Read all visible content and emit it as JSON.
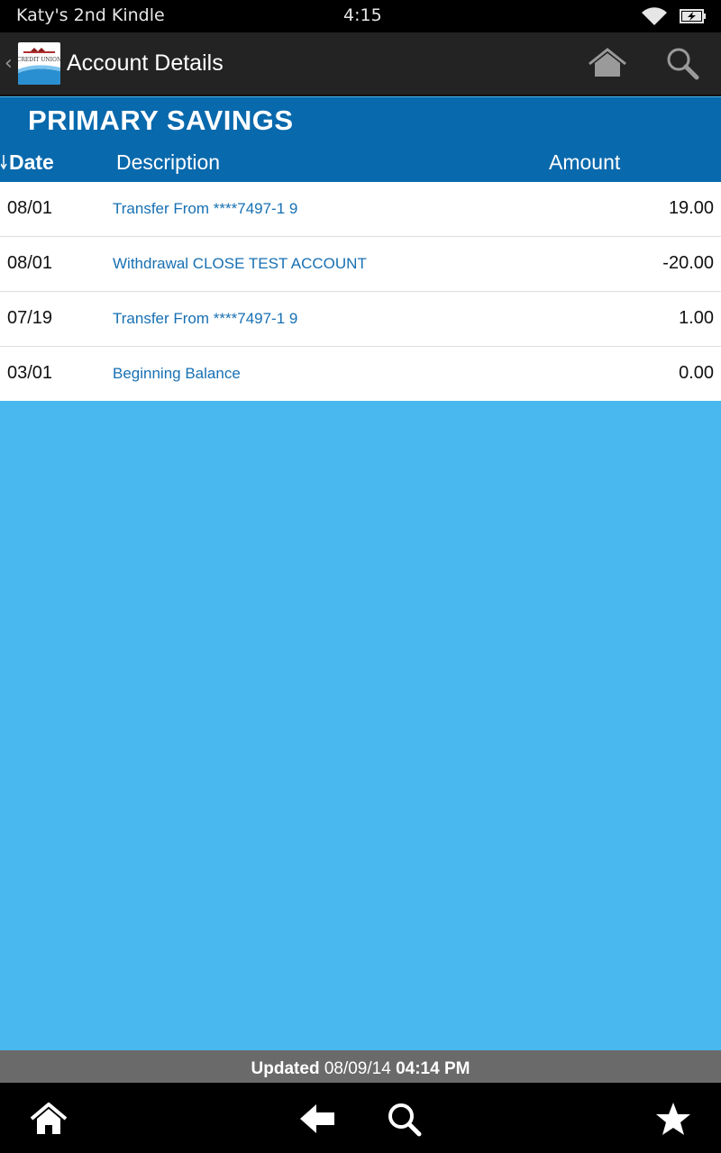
{
  "status_bar": {
    "device_name": "Katy's 2nd Kindle",
    "time": "4:15",
    "icons": [
      "wifi-icon",
      "battery-charging-icon"
    ]
  },
  "action_bar": {
    "logo_text": "CREDIT UNION",
    "title": "Account Details",
    "icons": [
      "home-icon",
      "search-icon"
    ]
  },
  "account": {
    "title": "PRIMARY SAVINGS",
    "columns": {
      "date": "Date",
      "description": "Description",
      "amount": "Amount"
    }
  },
  "transactions": [
    {
      "date": "08/01",
      "description": "Transfer From ****7497-1 9",
      "amount": "19.00"
    },
    {
      "date": "08/01",
      "description": "Withdrawal CLOSE TEST ACCOUNT",
      "amount": "-20.00"
    },
    {
      "date": "07/19",
      "description": "Transfer From ****7497-1 9",
      "amount": "1.00"
    },
    {
      "date": "03/01",
      "description": "Beginning Balance",
      "amount": "0.00"
    }
  ],
  "updated": {
    "label": "Updated",
    "date": "08/09/14",
    "time": "04:14 PM"
  },
  "bottom_nav": {
    "icons": [
      "home-icon",
      "back-arrow-icon",
      "search-icon",
      "star-icon"
    ]
  },
  "colors": {
    "header_blue": "#0969ad",
    "background_blue": "#48b8ee",
    "link_blue": "#1770b3",
    "action_bar": "#232323"
  }
}
